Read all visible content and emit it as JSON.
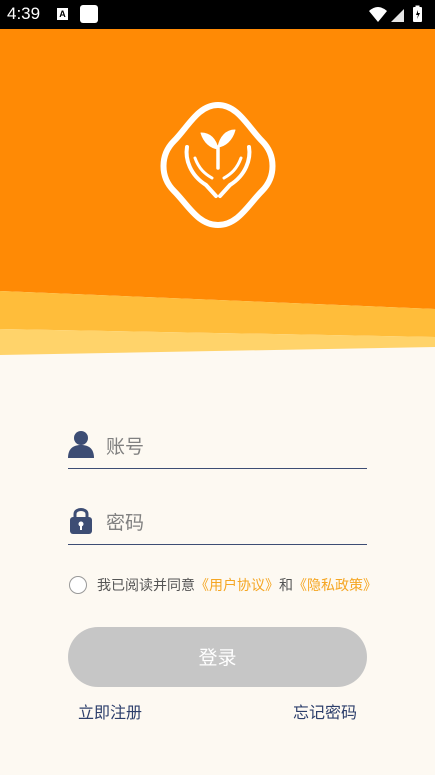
{
  "status_bar": {
    "time": "4:39",
    "icons": [
      "a-notification-icon",
      "square-notification-icon",
      "wifi-icon",
      "signal-icon",
      "battery-icon"
    ]
  },
  "colors": {
    "brand_orange": "#ff8a05",
    "accent_yellow": "#ffd36a",
    "primary_text": "#2c3e6b",
    "link_color": "#f5a623",
    "button_disabled": "#c6c6c6"
  },
  "form": {
    "username_placeholder": "账号",
    "password_placeholder": "密码"
  },
  "agreement": {
    "prefix": "我已阅读并同意",
    "user_agreement": "《用户协议》",
    "connector": "和",
    "privacy_policy": "《隐私政策》",
    "checked": false
  },
  "buttons": {
    "login": "登录",
    "register": "立即注册",
    "forgot_password": "忘记密码"
  }
}
